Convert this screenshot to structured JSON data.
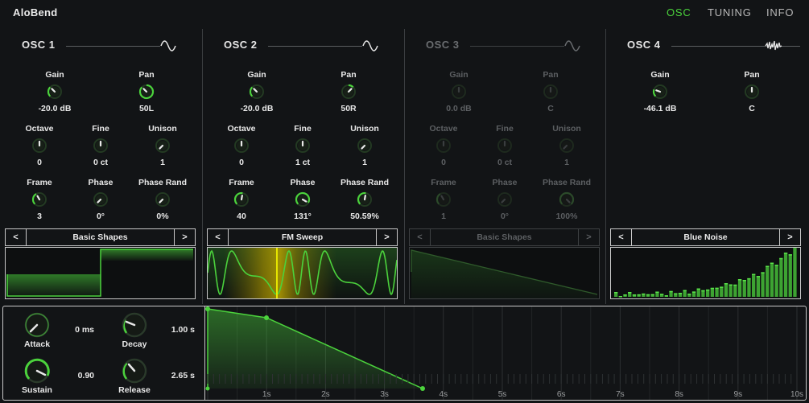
{
  "app": {
    "title": "AloBend"
  },
  "nav": [
    {
      "label": "OSC",
      "active": true
    },
    {
      "label": "TUNING",
      "active": false
    },
    {
      "label": "INFO",
      "active": false
    }
  ],
  "colors": {
    "accent": "#4bd23c",
    "bg": "#121416",
    "dim": "#5c5f62"
  },
  "oscillators": [
    {
      "name": "OSC 1",
      "icon": "sine-wave-icon",
      "params": {
        "gain": {
          "label": "Gain",
          "value": "-20.0 dB"
        },
        "pan": {
          "label": "Pan",
          "value": "50L"
        },
        "octave": {
          "label": "Octave",
          "value": "0"
        },
        "fine": {
          "label": "Fine",
          "value": "0 ct"
        },
        "unison": {
          "label": "Unison",
          "value": "1"
        },
        "frame": {
          "label": "Frame",
          "value": "3"
        },
        "phase": {
          "label": "Phase",
          "value": "0°"
        },
        "phase_rand": {
          "label": "Phase Rand",
          "value": "0%"
        }
      },
      "wavetable": {
        "prev": "<",
        "name": "Basic Shapes",
        "next": ">"
      }
    },
    {
      "name": "OSC 2",
      "icon": "sine-wave-icon",
      "params": {
        "gain": {
          "label": "Gain",
          "value": "-20.0 dB"
        },
        "pan": {
          "label": "Pan",
          "value": "50R"
        },
        "octave": {
          "label": "Octave",
          "value": "0"
        },
        "fine": {
          "label": "Fine",
          "value": "1 ct"
        },
        "unison": {
          "label": "Unison",
          "value": "1"
        },
        "frame": {
          "label": "Frame",
          "value": "40"
        },
        "phase": {
          "label": "Phase",
          "value": "131°"
        },
        "phase_rand": {
          "label": "Phase Rand",
          "value": "50.59%"
        }
      },
      "wavetable": {
        "prev": "<",
        "name": "FM Sweep",
        "next": ">"
      }
    },
    {
      "name": "OSC 3",
      "icon": "sine-wave-icon",
      "disabled": true,
      "params": {
        "gain": {
          "label": "Gain",
          "value": "0.0 dB"
        },
        "pan": {
          "label": "Pan",
          "value": "C"
        },
        "octave": {
          "label": "Octave",
          "value": "0"
        },
        "fine": {
          "label": "Fine",
          "value": "0 ct"
        },
        "unison": {
          "label": "Unison",
          "value": "1"
        },
        "frame": {
          "label": "Frame",
          "value": "1"
        },
        "phase": {
          "label": "Phase",
          "value": "0°"
        },
        "phase_rand": {
          "label": "Phase Rand",
          "value": "100%"
        }
      },
      "wavetable": {
        "prev": "<",
        "name": "Basic Shapes",
        "next": ">"
      }
    },
    {
      "name": "OSC 4",
      "icon": "noise-wave-icon",
      "params": {
        "gain": {
          "label": "Gain",
          "value": "-46.1 dB"
        },
        "pan": {
          "label": "Pan",
          "value": "C"
        }
      },
      "wavetable": {
        "prev": "<",
        "name": "Blue Noise",
        "next": ">"
      }
    }
  ],
  "envelope": {
    "attack": {
      "label": "Attack",
      "value": "0 ms"
    },
    "decay": {
      "label": "Decay",
      "value": "1.00 s"
    },
    "sustain": {
      "label": "Sustain",
      "value": "0.90"
    },
    "release": {
      "label": "Release",
      "value": "2.65 s"
    },
    "time_axis": [
      "1s",
      "2s",
      "3s",
      "4s",
      "5s",
      "6s",
      "7s",
      "8s",
      "9s",
      "10s"
    ]
  }
}
